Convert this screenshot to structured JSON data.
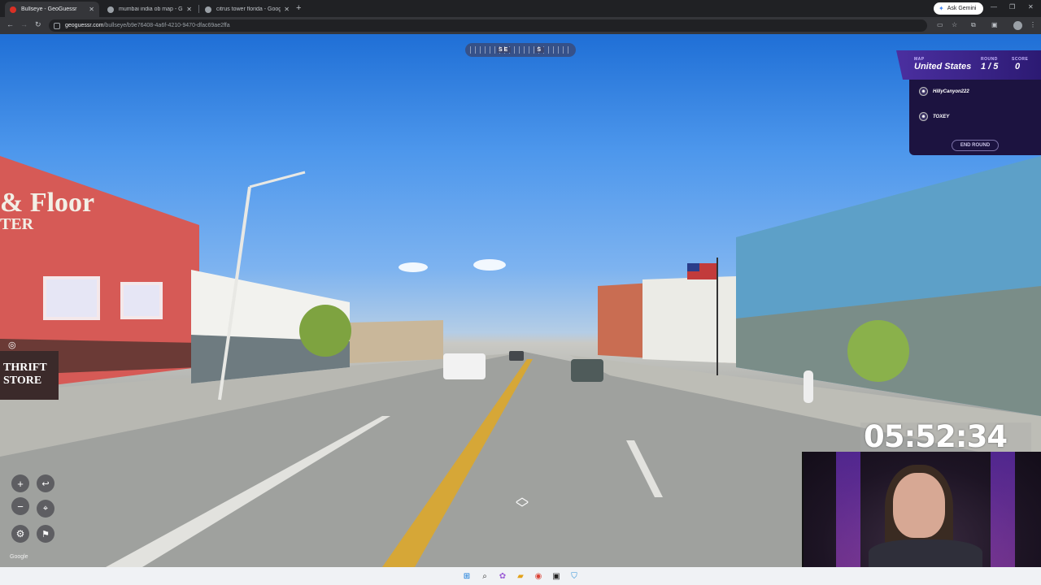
{
  "browser": {
    "tabs": [
      {
        "label": "Bullseye - GeoGuessr",
        "active": true,
        "favicon_color": "#d93025"
      },
      {
        "label": "mumbai india ob map - Google",
        "active": false,
        "favicon_color": "#9aa0a6"
      },
      {
        "label": "citrus tower florida - Google Se",
        "active": false,
        "favicon_color": "#9aa0a6"
      }
    ],
    "new_tab_icon": "plus-icon",
    "gemini_label": "Ask Gemini",
    "url_host": "geoguessr.com",
    "url_path": "/bullseye/b9e76408-4a6f-4210-9470-dfac69ae2ffa",
    "nav_icons": [
      "back-icon",
      "forward-icon",
      "reload-icon"
    ]
  },
  "compass": {
    "labels": [
      "SE",
      "S"
    ]
  },
  "game": {
    "map_label": "MAP",
    "map_value": "United States",
    "round_label": "ROUND",
    "round_value": "1 / 5",
    "score_label": "SCORE",
    "score_value": "0",
    "players": [
      "HillyCanyon222",
      "TOXEY"
    ],
    "end_round_label": "END ROUND",
    "accent_color": "#4b2fa0"
  },
  "timer": {
    "value": "05:52:34"
  },
  "controls": {
    "zoom_in": "+",
    "zoom_out": "−",
    "undo_icon": "return-icon",
    "pin_icon": "location-pin-icon",
    "settings_icon": "gear-icon",
    "flag_icon": "flag-icon",
    "google_mark": "Google"
  },
  "taskbar": {
    "apps": [
      "windows-start-icon",
      "search-icon",
      "copilot-icon",
      "file-explorer-icon",
      "chrome-icon",
      "terminal-icon",
      "shield-icon"
    ]
  }
}
